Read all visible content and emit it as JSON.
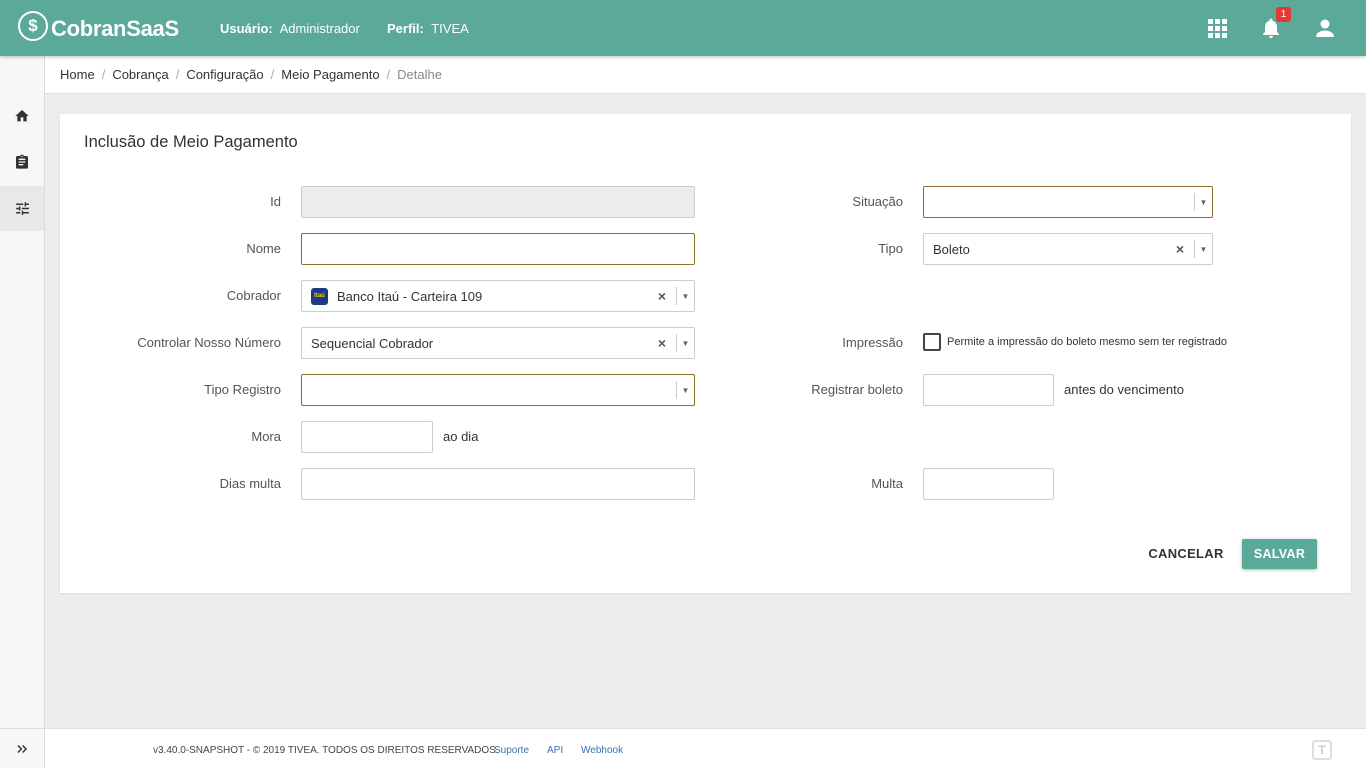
{
  "app": {
    "brand": "CobranSaaS",
    "brand_mark": "$",
    "user_label": "Usuário:",
    "user_value": "Administrador",
    "profile_label": "Perfil:",
    "profile_value": "TIVEA",
    "notification_count": "1",
    "accent_color": "#5aa999"
  },
  "sidebar": {
    "items": [
      {
        "icon": "home-icon"
      },
      {
        "icon": "clipboard-icon"
      },
      {
        "icon": "settings-sliders-icon"
      }
    ],
    "expand_icon": "double-chevron-right-icon"
  },
  "breadcrumb": [
    "Home",
    "Cobrança",
    "Configuração",
    "Meio Pagamento",
    "Detalhe"
  ],
  "form": {
    "title": "Inclusão de Meio Pagamento",
    "id_label": "Id",
    "id_value": "",
    "nome_label": "Nome",
    "nome_value": "",
    "cobrador_label": "Cobrador",
    "cobrador_value": "Banco Itaú - Carteira 109",
    "cobrador_bank_logo": "Itaú",
    "controlar_label": "Controlar Nosso Número",
    "controlar_value": "Sequencial Cobrador",
    "tipo_registro_label": "Tipo Registro",
    "tipo_registro_value": "",
    "mora_label": "Mora",
    "mora_value": "",
    "mora_suffix": "ao dia",
    "dias_multa_label": "Dias multa",
    "dias_multa_value": "",
    "situacao_label": "Situação",
    "situacao_value": "",
    "tipo_label": "Tipo",
    "tipo_value": "Boleto",
    "impressao_label": "Impressão",
    "impressao_checked": false,
    "impressao_text": "Permite a impressão do boleto mesmo sem ter registrado",
    "registrar_label": "Registrar boleto",
    "registrar_value": "",
    "registrar_suffix": "antes do vencimento",
    "multa_label": "Multa",
    "multa_value": "",
    "clear_glyph": "×",
    "arrow_glyph": "▼",
    "cancel_label": "CANCELAR",
    "save_label": "SALVAR"
  },
  "footer": {
    "copyright": "v3.40.0-SNAPSHOT - © 2019 TIVEA. TODOS OS DIREITOS RESERVADOS.",
    "links": [
      "Suporte",
      "API",
      "Webhook"
    ],
    "logo_glyph": "T"
  }
}
